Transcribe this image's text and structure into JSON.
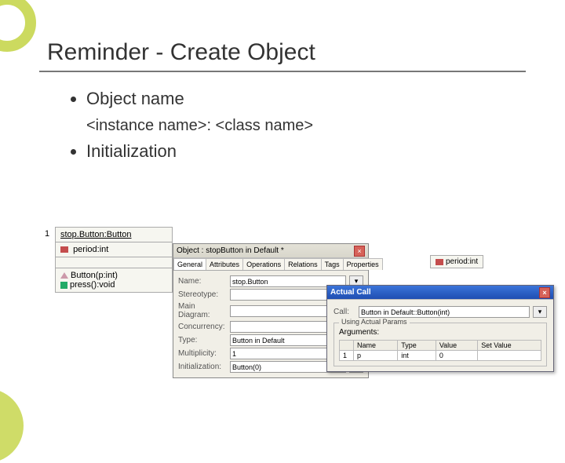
{
  "slide": {
    "title": "Reminder - Create Object",
    "bullets": [
      "Object name",
      "<instance name>: <class name>",
      "Initialization"
    ]
  },
  "uml": {
    "index": "1",
    "header": "stop.Button:Button",
    "attr1": "period:int",
    "op1": "Button(p:int)",
    "op2": "press():void"
  },
  "object_dialog": {
    "title": "Object : stopButton in Default *",
    "tabs": [
      "General",
      "Attributes",
      "Operations",
      "Relations",
      "Tags",
      "Properties"
    ],
    "fields": {
      "name_label": "Name:",
      "name_value": "stop.Button",
      "stereotype_label": "Stereotype:",
      "stereotype_value": "",
      "maindiagram_label": "Main Diagram:",
      "maindiagram_value": "",
      "concurrency_label": "Concurrency:",
      "concurrency_value": "",
      "type_label": "Type:",
      "type_value": "Button in Default",
      "multiplicity_label": "Multiplicity:",
      "multiplicity_value": "1",
      "initialization_label": "Initialization:",
      "initialization_value": "Button(0)",
      "btn_dots": "..."
    }
  },
  "actual_call": {
    "title": "Actual Call",
    "call_label": "Call:",
    "call_value": "Button in Default::Button(int)",
    "group_label": "Using Actual Params",
    "args_label": "Arguments:",
    "columns": [
      "",
      "Name",
      "Type",
      "Value",
      "Set Value"
    ],
    "row": {
      "idx": "1",
      "name": "p",
      "type": "int",
      "value": "0",
      "setvalue": ""
    }
  },
  "period_snippet": "period:int"
}
